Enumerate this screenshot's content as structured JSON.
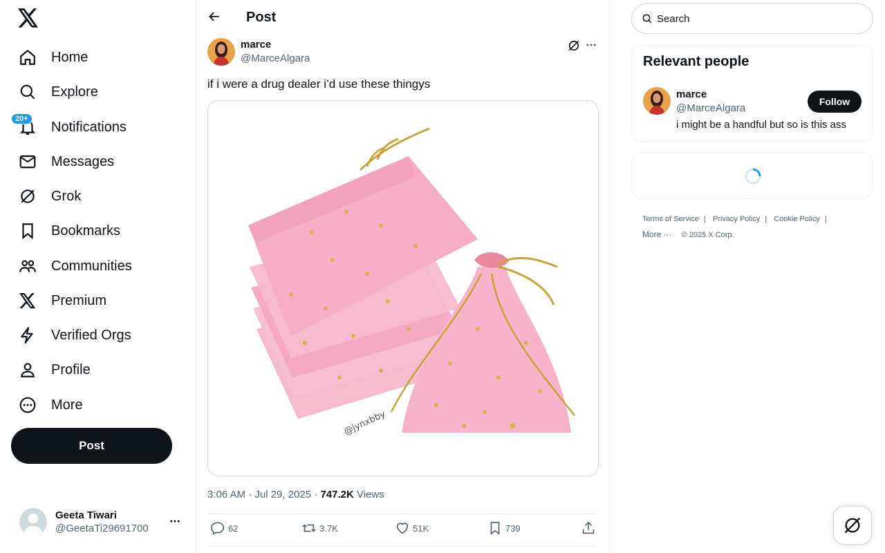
{
  "nav": {
    "items": [
      {
        "label": "Home",
        "icon": "home-icon"
      },
      {
        "label": "Explore",
        "icon": "search-icon"
      },
      {
        "label": "Notifications",
        "icon": "bell-icon",
        "badge": "20+"
      },
      {
        "label": "Messages",
        "icon": "envelope-icon"
      },
      {
        "label": "Grok",
        "icon": "grok-icon"
      },
      {
        "label": "Bookmarks",
        "icon": "bookmark-icon"
      },
      {
        "label": "Communities",
        "icon": "people-icon"
      },
      {
        "label": "Premium",
        "icon": "x-logo-icon"
      },
      {
        "label": "Verified Orgs",
        "icon": "lightning-icon"
      },
      {
        "label": "Profile",
        "icon": "person-icon"
      },
      {
        "label": "More",
        "icon": "more-circle-icon"
      }
    ],
    "post_button": "Post"
  },
  "account": {
    "name": "Geeta Tiwari",
    "handle": "@GeetaTi29691700"
  },
  "main": {
    "header_title": "Post",
    "tweet": {
      "author_name": "marce",
      "author_handle": "@MarceAlgara",
      "text": "if i were a drug dealer i’d use these thingys",
      "image_watermark": "@jynxbby",
      "timestamp": "3:06 AM · Jul 29, 2025 · ",
      "views_count": "747.2K",
      "views_label": " Views",
      "replies": "62",
      "reposts": "3.7K",
      "likes": "51K",
      "bookmarks": "739"
    }
  },
  "right": {
    "search_placeholder": "Search",
    "relevant_title": "Relevant people",
    "person": {
      "name": "marce",
      "handle": "@MarceAlgara",
      "bio": "i might be a handful but so is this ass",
      "follow_label": "Follow"
    },
    "footer": {
      "links": [
        "Terms of Service",
        "Privacy Policy",
        "Cookie Policy"
      ],
      "more": "More ···",
      "copyright": "© 2025 X Corp."
    }
  },
  "colors": {
    "accent": "#1d9bf0",
    "text": "#0f1419",
    "muted": "#536471",
    "pink": "#f4a6c1"
  }
}
